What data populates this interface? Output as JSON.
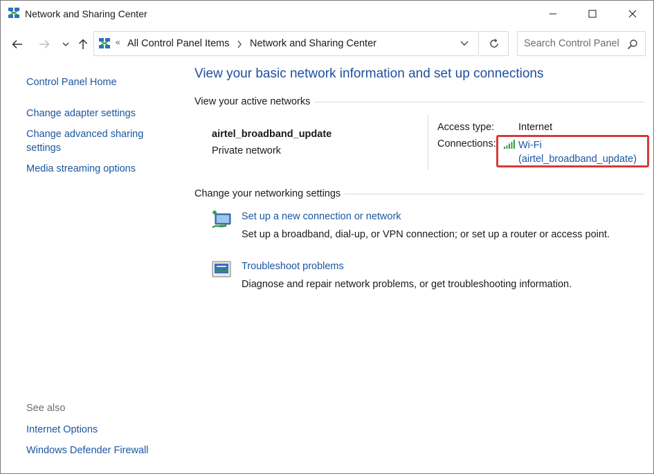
{
  "window": {
    "title": "Network and Sharing Center"
  },
  "address": {
    "overflow": "«",
    "crumbs": [
      "All Control Panel Items",
      "Network and Sharing Center"
    ],
    "search_placeholder": "Search Control Panel"
  },
  "sidebar": {
    "items": [
      {
        "label": "Control Panel Home"
      },
      {
        "label": "Change adapter settings"
      },
      {
        "label": "Change advanced sharing settings"
      },
      {
        "label": "Media streaming options"
      }
    ],
    "see_also_heading": "See also",
    "see_also": [
      {
        "label": "Internet Options"
      },
      {
        "label": "Windows Defender Firewall"
      }
    ]
  },
  "main": {
    "title": "View your basic network information and set up connections",
    "active_heading": "View your active networks",
    "network": {
      "name": "airtel_broadband_update",
      "category": "Private network",
      "access_label": "Access type:",
      "access_value": "Internet",
      "connections_label": "Connections:",
      "connection_line1": "Wi-Fi",
      "connection_line2": "(airtel_broadband_update)"
    },
    "settings_heading": "Change your networking settings",
    "tasks": [
      {
        "link": "Set up a new connection or network",
        "desc": "Set up a broadband, dial-up, or VPN connection; or set up a router or access point.",
        "icon": "new-connection-icon"
      },
      {
        "link": "Troubleshoot problems",
        "desc": "Diagnose and repair network problems, or get troubleshooting information.",
        "icon": "troubleshoot-icon"
      }
    ]
  },
  "colors": {
    "link": "#1a56a0",
    "title": "#1e4e9c",
    "highlight": "#d63a3a"
  }
}
